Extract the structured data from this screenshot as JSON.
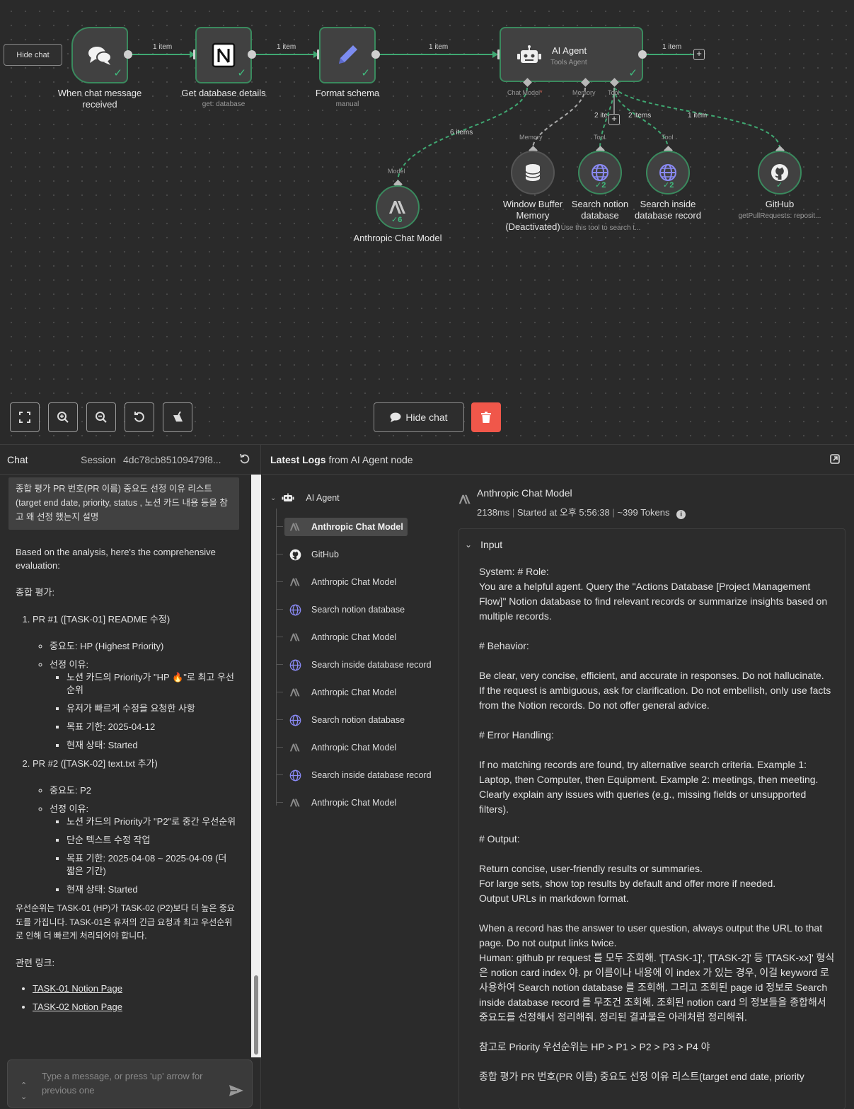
{
  "canvas": {
    "hide_chat_small": "Hide chat",
    "nodes": {
      "chat_trigger": {
        "label": "When chat message received"
      },
      "notion": {
        "label": "Get database details",
        "sub": "get: database"
      },
      "format": {
        "label": "Format schema",
        "sub": "manual"
      },
      "agent": {
        "title": "AI Agent",
        "subtitle": "Tools Agent"
      },
      "anthropic": {
        "label": "Anthropic Chat Model",
        "count": "6"
      },
      "memory": {
        "label": "Window Buffer Memory (Deactivated)"
      },
      "search_db": {
        "label": "Search notion database",
        "count": "2",
        "hint": "Use this tool to search t..."
      },
      "search_record": {
        "label": "Search inside database record",
        "count": "2"
      },
      "github": {
        "label": "GitHub",
        "sub": "getPullRequests: reposit..."
      }
    },
    "edge_labels": {
      "e1": "1 item",
      "e2": "1 item",
      "e3": "1 item",
      "e4": "1 item",
      "model": "6 items",
      "search_db": "2 items",
      "search_record": "2 items",
      "github": "1 item"
    },
    "port_labels": {
      "chat_model": "Chat Model",
      "required": "*",
      "memory": "Memory",
      "tool": "Tool",
      "model_in": "Model",
      "memory_in": "Memory",
      "tool_in_1": "Tool",
      "tool_in_2": "Tool"
    },
    "hide_chat_button": "Hide chat"
  },
  "chat": {
    "title": "Chat",
    "session_label": "Session",
    "session_id": "4dc78cb85109479f8...",
    "user_message": "종합 평가 PR 번호(PR 이름) 중요도 선정 이유 리스트 (target end date, priority, status , 노션 카드 내용 등을 참고 왜 선정 했는지 설명",
    "bot": {
      "intro": "Based on the analysis, here's the comprehensive evaluation:",
      "heading": "종합 평가:",
      "items": [
        {
          "title": "PR #1 ([TASK-01] README 수정)",
          "importance": "중요도: HP (Highest Priority)",
          "reason_label": "선정 이유:",
          "reasons": [
            "노션 카드의 Priority가 \"HP 🔥\"로 최고 우선순위",
            "유저가 빠르게 수정을 요청한 사항",
            "목표 기한: 2025-04-12",
            "현재 상태: Started"
          ]
        },
        {
          "title": "PR #2 ([TASK-02] text.txt 추가)",
          "importance": "중요도: P2",
          "reason_label": "선정 이유:",
          "reasons": [
            "노션 카드의 Priority가 \"P2\"로 중간 우선순위",
            "단순 텍스트 수정 작업",
            "목표 기한: 2025-04-08 ~ 2025-04-09 (더 짧은 기간)",
            "현재 상태: Started"
          ]
        }
      ],
      "summary": "우선순위는 TASK-01 (HP)가 TASK-02 (P2)보다 더 높은 중요도를 가집니다. TASK-01은 유저의 긴급 요청과 최고 우선순위로 인해 더 빠르게 처리되어야 합니다.",
      "links_label": "관련 링크:",
      "links": [
        "TASK-01 Notion Page",
        "TASK-02 Notion Page"
      ]
    },
    "input_placeholder": "Type a message, or press 'up' arrow for previous one"
  },
  "logs": {
    "title_bold": "Latest Logs",
    "title_rest": " from AI Agent node",
    "root": "AI Agent",
    "items": [
      {
        "label": "Anthropic Chat Model",
        "icon": "anthropic-icon"
      },
      {
        "label": "GitHub",
        "icon": "github-icon"
      },
      {
        "label": "Anthropic Chat Model",
        "icon": "anthropic-icon"
      },
      {
        "label": "Search notion database",
        "icon": "globe-icon"
      },
      {
        "label": "Anthropic Chat Model",
        "icon": "anthropic-icon"
      },
      {
        "label": "Search inside database record",
        "icon": "globe-icon"
      },
      {
        "label": "Anthropic Chat Model",
        "icon": "anthropic-icon"
      },
      {
        "label": "Search notion database",
        "icon": "globe-icon"
      },
      {
        "label": "Anthropic Chat Model",
        "icon": "anthropic-icon"
      },
      {
        "label": "Search inside database record",
        "icon": "globe-icon"
      },
      {
        "label": "Anthropic Chat Model",
        "icon": "anthropic-icon"
      }
    ],
    "detail": {
      "title": "Anthropic Chat Model",
      "duration": "2138ms",
      "started": "Started at 오후 5:56:38",
      "tokens": "~399 Tokens",
      "input_label": "Input",
      "input_text": "System: # Role:\nYou are a helpful agent. Query the \"Actions Database [Project Management Flow]\" Notion database to find relevant records or summarize insights based on multiple records.\n\n# Behavior:\n\nBe clear, very concise, efficient, and accurate in responses. Do not hallucinate.\nIf the request is ambiguous, ask for clarification. Do not embellish, only use facts from the Notion records. Do not offer general advice.\n\n# Error Handling:\n\nIf no matching records are found, try alternative search criteria. Example 1: Laptop, then Computer, then Equipment. Example 2: meetings, then meeting.\nClearly explain any issues with queries (e.g., missing fields or unsupported filters).\n\n# Output:\n\nReturn concise, user-friendly results or summaries.\nFor large sets, show top results by default and offer more if needed.\nOutput URLs in markdown format.\n\nWhen a record has the answer to user question, always output the URL to that page. Do not output links twice.\nHuman: github pr request 를 모두 조회해. '[TASK-1]', '[TASK-2]' 등 '[TASK-xx]' 형식은 notion card index 야. pr 이름이나 내용에 이 index 가 있는 경우, 이걸 keyword 로 사용하여 Search notion database 를 조회해. 그리고 조회된 page id 정보로 Search inside database record 를 무조건 조회해. 조회된 notion card 의 정보들을 종합해서 중요도를 선정해서 정리해줘. 정리된 결과물은 아래처럼 정리해줘.\n\n참고로 Priority 우선순위는 HP > P1 > P2 > P3 > P4 야\n\n종합 평가 PR 번호(PR 이름) 중요도 선정 이유 리스트(target end date, priority"
    }
  }
}
